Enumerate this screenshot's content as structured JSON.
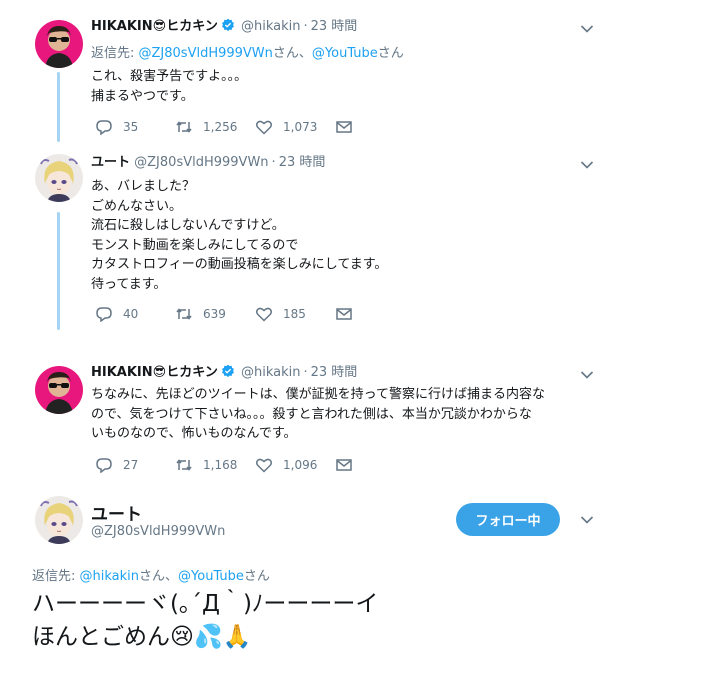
{
  "tweets": [
    {
      "name": "HIKAKIN",
      "name_emoji": "😎",
      "name_suffix": "ヒカキン",
      "handle": "@hikakin",
      "dot": "·",
      "time": "23 時間",
      "reply_prefix": "返信先: ",
      "reply_user1": "@ZJ80sVldH999VWn",
      "reply_sep": "さん、",
      "reply_user2": "@YouTube",
      "reply_suffix": "さん",
      "lines": [
        "これ、殺害予告ですよ。。。",
        "捕まるやつです。"
      ],
      "replies": "35",
      "retweets": "1,256",
      "likes": "1,073"
    },
    {
      "name": "ユート",
      "handle": "@ZJ80sVldH999VWn",
      "dot": "·",
      "time": "23 時間",
      "lines": [
        "あ、バレました？",
        "ごめんなさい。",
        "流石に殺しはしないんですけど。",
        "モンスト動画を楽しみにしてるので",
        "カタストロフィーの動画投稿を楽しみにしてます。",
        "待ってます。"
      ],
      "replies": "40",
      "retweets": "639",
      "likes": "185"
    },
    {
      "name": "HIKAKIN",
      "name_emoji": "😎",
      "name_suffix": "ヒカキン",
      "handle": "@hikakin",
      "dot": "·",
      "time": "23 時間",
      "lines": [
        "ちなみに、先ほどのツイートは、僕が証拠を持って警察に行けば捕まる内容な",
        "ので、気をつけて下さいね。。。殺すと言われた側は、本当か冗談かわからな",
        "いものなので、怖いものなんです。"
      ],
      "replies": "27",
      "retweets": "1,168",
      "likes": "1,096"
    }
  ],
  "main_tweet": {
    "name": "ユート",
    "handle": "@ZJ80sVldH999VWn",
    "follow_label": "フォロー中",
    "reply_prefix": "返信先: ",
    "reply_user1": "@hikakin",
    "reply_sep": "さん、",
    "reply_user2": "@YouTube",
    "reply_suffix": "さん",
    "line1": "ハーーーーヾ(｡´Д｀)ﾉーーーーイ",
    "line2": "ほんとごめん😢💦🙏"
  },
  "colors": {
    "accent": "#1da1f2",
    "thread_line": "#a6d4f2",
    "follow_button": "#3aa3e8",
    "secondary_text": "#657786"
  },
  "icons": [
    "reply-icon",
    "retweet-icon",
    "like-icon",
    "dm-icon",
    "verified-icon",
    "chevron-down-icon"
  ]
}
